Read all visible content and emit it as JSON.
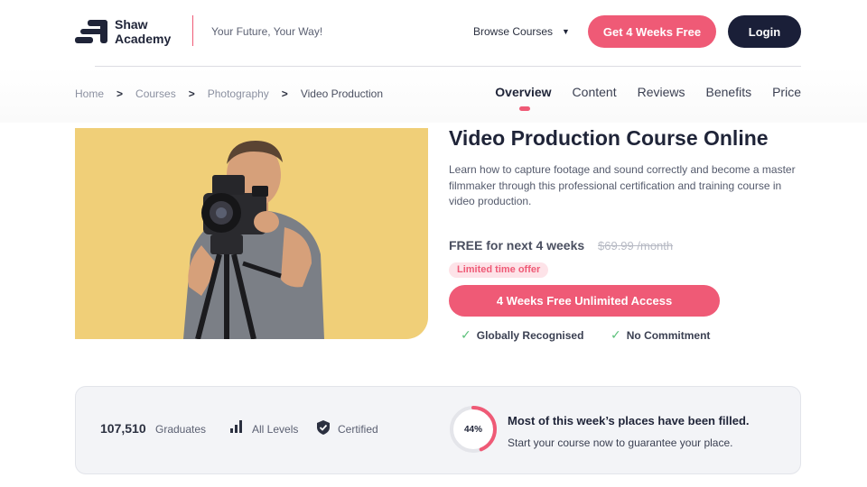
{
  "header": {
    "brand_line1": "Shaw",
    "brand_line2": "Academy",
    "tagline": "Your Future, Your Way!",
    "browse_label": "Browse Courses",
    "free_button": "Get 4 Weeks Free",
    "login_button": "Login"
  },
  "breadcrumb": [
    "Home",
    "Courses",
    "Photography",
    "Video Production"
  ],
  "tabs": [
    "Overview",
    "Content",
    "Reviews",
    "Benefits",
    "Price"
  ],
  "course": {
    "title": "Video Production Course Online",
    "description": "Learn how to capture footage and sound correctly and become a master filmmaker through this professional certification and training course in video production.",
    "price_label": "FREE for next 4 weeks",
    "old_price": "$69.99 /month",
    "offer_badge": "Limited time offer",
    "cta": "4 Weeks Free Unlimited Access",
    "checks": [
      "Globally Recognised",
      "No Commitment"
    ]
  },
  "stats": {
    "graduates_count": "107,510",
    "graduates_label": "Graduates",
    "levels_label": "All Levels",
    "certified_label": "Certified",
    "progress_percent": 44,
    "progress_text": "44%",
    "fill_title": "Most of this week’s places have been filled.",
    "fill_subtitle": "Start your course now to guarantee your place."
  },
  "colors": {
    "accent": "#ef5a76",
    "navy": "#1a1f38",
    "hero_bg": "#f0cf78",
    "check_green": "#5cc17b"
  }
}
